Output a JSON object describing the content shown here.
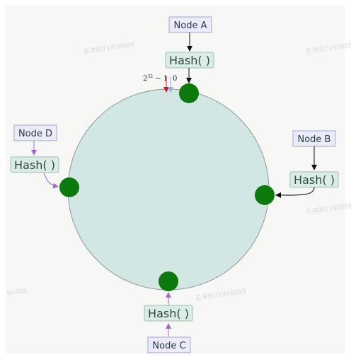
{
  "nodes": {
    "a": {
      "label": "Node A",
      "hash_label": "Hash( )"
    },
    "b": {
      "label": "Node B",
      "hash_label": "Hash( )"
    },
    "c": {
      "label": "Node C",
      "hash_label": "Hash( )"
    },
    "d": {
      "label": "Node D",
      "hash_label": "Hash( )"
    }
  },
  "ring_range": {
    "max_base": "2",
    "max_exponent": "32",
    "max_suffix": " − 1",
    "zero": "0"
  },
  "colors": {
    "background": "#f7f7f6",
    "ring_fill": "#d2e6e3",
    "ring_stroke": "#8a9a97",
    "node_box_fill": "#ecebfa",
    "node_box_stroke": "#a4a4cc",
    "hash_box_fill": "#dbebe6",
    "hash_box_stroke": "#9cbfb4",
    "server_dot": "#0a7a0a",
    "arrow_black": "#111111",
    "arrow_purple": "#9b6ad6",
    "marker_red": "#cc1a1a",
    "marker_blue": "#86b8e8"
  }
}
